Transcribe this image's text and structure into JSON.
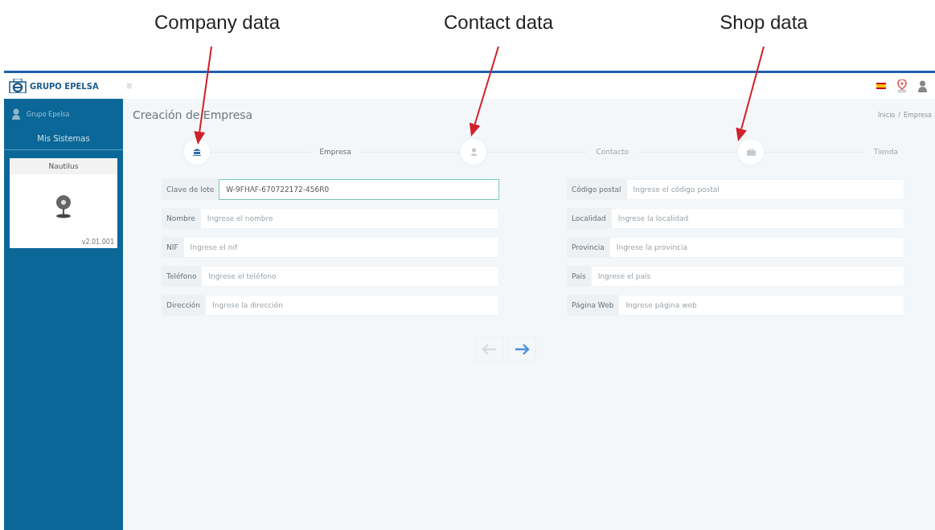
{
  "annotations": [
    {
      "label": "Company data"
    },
    {
      "label": "Contact data"
    },
    {
      "label": "Shop data"
    }
  ],
  "header": {
    "logo_text": "GRUPO EPELSA",
    "menu_glyph": "≡"
  },
  "sidebar": {
    "user": "Grupo Epelsa",
    "section": "Mis Sistemas",
    "systems": [
      {
        "name": "Nautilus",
        "version": "v2.01.001"
      }
    ]
  },
  "page": {
    "title": "Creación de Empresa",
    "breadcrumb": [
      "Inicio",
      "Empresa"
    ],
    "breadcrumb_separator": "/"
  },
  "steps": [
    {
      "label": "Empresa",
      "selected": true
    },
    {
      "label": "Contacto",
      "selected": false
    },
    {
      "label": "Tienda",
      "selected": false
    }
  ],
  "form_left": [
    {
      "label": "Clave de lote",
      "value": "W-9FHAF-670722172-456R0",
      "focused": true
    },
    {
      "label": "Nombre",
      "placeholder": "Ingrese el nombre",
      "focused": false
    },
    {
      "label": "NIF",
      "placeholder": "Ingrese el nif",
      "focused": false
    },
    {
      "label": "Teléfono",
      "placeholder": "Ingrese el teléfono",
      "focused": false
    },
    {
      "label": "Dirección",
      "placeholder": "Ingrese la dirección",
      "focused": false
    }
  ],
  "form_right": [
    {
      "label": "Código postal",
      "placeholder": "Ingrese el código postal",
      "focused": false
    },
    {
      "label": "Localidad",
      "placeholder": "Ingrese la localidad",
      "focused": false
    },
    {
      "label": "Provincia",
      "placeholder": "Ingrese la provincia",
      "focused": false
    },
    {
      "label": "País",
      "placeholder": "Ingrese el país",
      "focused": false
    },
    {
      "label": "Página Web",
      "placeholder": "Ingrese página web",
      "focused": false
    }
  ],
  "nav_buttons": [
    {
      "kind": "previous",
      "disabled": true
    },
    {
      "kind": "next",
      "disabled": false
    }
  ]
}
